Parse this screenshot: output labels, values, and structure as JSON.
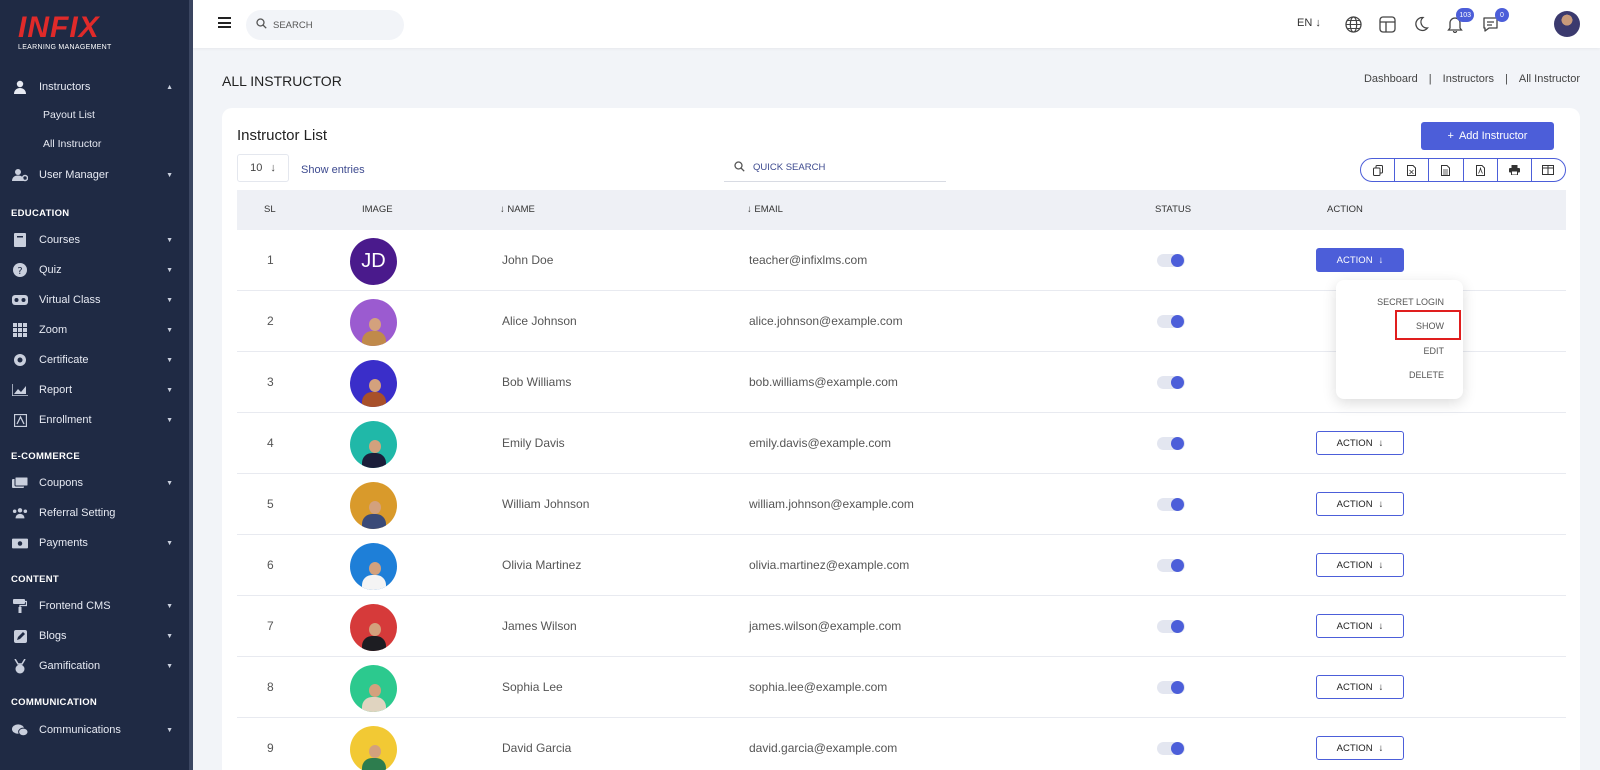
{
  "logo": {
    "main": "INFIX",
    "sub": "LEARNING MANAGEMENT"
  },
  "sidebar": {
    "instructors": "Instructors",
    "payout_list": "Payout List",
    "all_instructor": "All Instructor",
    "user_manager": "User Manager",
    "section_education": "EDUCATION",
    "courses": "Courses",
    "quiz": "Quiz",
    "virtual_class": "Virtual Class",
    "zoom": "Zoom",
    "certificate": "Certificate",
    "report": "Report",
    "enrollment": "Enrollment",
    "section_ecommerce": "E-COMMERCE",
    "coupons": "Coupons",
    "referral_setting": "Referral Setting",
    "payments": "Payments",
    "section_content": "CONTENT",
    "frontend_cms": "Frontend CMS",
    "blogs": "Blogs",
    "gamification": "Gamification",
    "section_communication": "COMMUNICATION",
    "communications": "Communications"
  },
  "topbar": {
    "search_placeholder": "SEARCH",
    "language": "EN",
    "notifications_count": "103",
    "messages_count": "0"
  },
  "page": {
    "title": "ALL INSTRUCTOR",
    "breadcrumb": [
      "Dashboard",
      "Instructors",
      "All Instructor"
    ]
  },
  "card": {
    "title": "Instructor List",
    "add_button": "Add Instructor",
    "entries_value": "10",
    "show_entries": "Show entries",
    "quick_search_placeholder": "QUICK SEARCH"
  },
  "table": {
    "headers": {
      "sl": "SL",
      "image": "IMAGE",
      "name": "NAME",
      "email": "EMAIL",
      "status": "STATUS",
      "action": "ACTION"
    },
    "action_label": "ACTION",
    "rows": [
      {
        "sl": "1",
        "initials": "JD",
        "name": "John Doe",
        "email": "teacher@infixlms.com"
      },
      {
        "sl": "2",
        "name": "Alice Johnson",
        "email": "alice.johnson@example.com"
      },
      {
        "sl": "3",
        "name": "Bob Williams",
        "email": "bob.williams@example.com"
      },
      {
        "sl": "4",
        "name": "Emily Davis",
        "email": "emily.davis@example.com"
      },
      {
        "sl": "5",
        "name": "William Johnson",
        "email": "william.johnson@example.com"
      },
      {
        "sl": "6",
        "name": "Olivia Martinez",
        "email": "olivia.martinez@example.com"
      },
      {
        "sl": "7",
        "name": "James Wilson",
        "email": "james.wilson@example.com"
      },
      {
        "sl": "8",
        "name": "Sophia Lee",
        "email": "sophia.lee@example.com"
      },
      {
        "sl": "9",
        "name": "David Garcia",
        "email": "david.garcia@example.com"
      }
    ]
  },
  "dropdown": {
    "secret_login": "SECRET LOGIN",
    "show": "SHOW",
    "edit": "EDIT",
    "delete": "DELETE"
  },
  "colors": {
    "accent": "#4c5ed9",
    "sidebar_bg": "#1f2a44",
    "logo_red": "#e02a2a",
    "highlight": "#e01e1e"
  }
}
